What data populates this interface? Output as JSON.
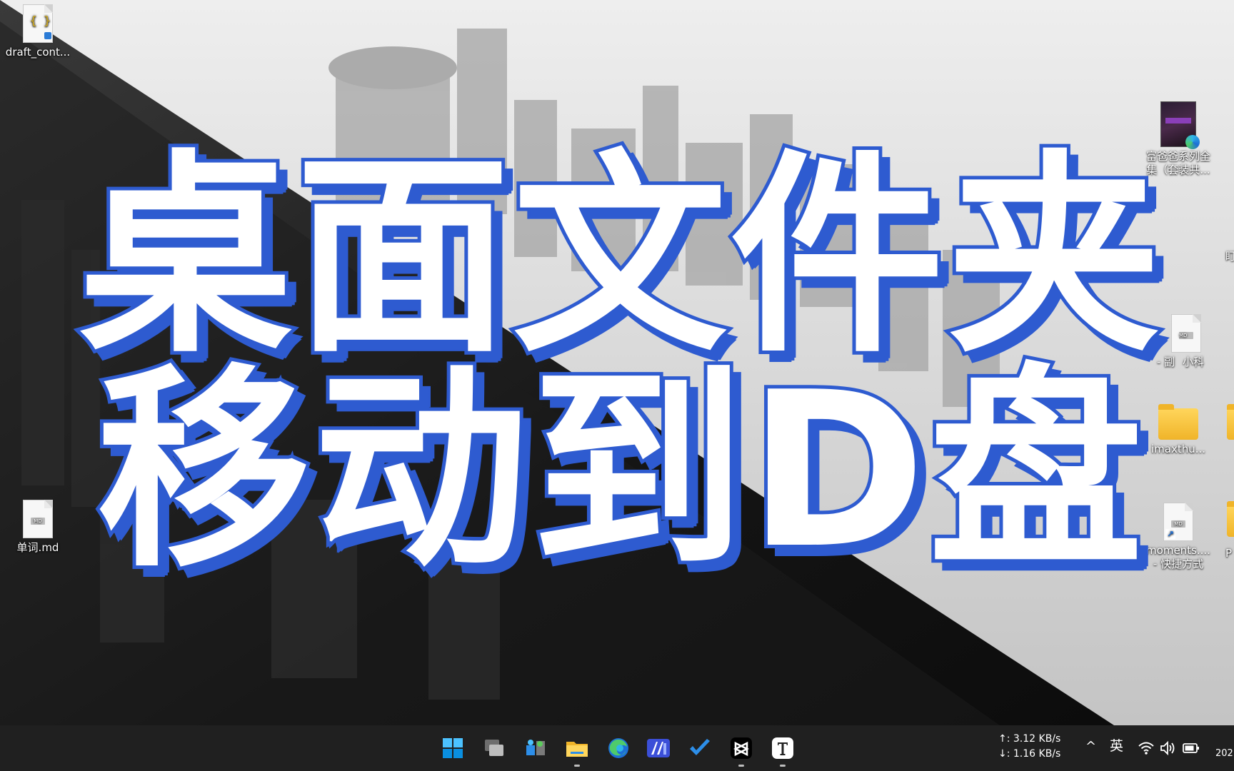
{
  "desktop": {
    "icons_left": [
      {
        "label": "draft_cont...",
        "kind": "json-file"
      },
      {
        "label": "单词.md",
        "kind": "md-file"
      }
    ],
    "icons_right": [
      {
        "label_line1": "富爸爸系列全",
        "label_line2": "集（套装共...",
        "kind": "ebook-shortcut"
      },
      {
        "label_line1": "- 副",
        "label_line2": "小科",
        "kind": "md-file-partial"
      },
      {
        "label_line1": "imaxthu...",
        "label_line2": "",
        "kind": "folder"
      },
      {
        "label_line1": "moments....",
        "label_line2": "- 快捷方式",
        "kind": "md-shortcut"
      }
    ],
    "right_edge_fragments": [
      "盯",
      "P"
    ]
  },
  "overlay_title": {
    "line1": "桌面文件夹",
    "line2": "移动到D盘",
    "fill_color": "#ffffff",
    "outline_color": "#2e5bd0"
  },
  "taskbar": {
    "apps": [
      {
        "name": "start-button",
        "icon": "windows-logo-icon"
      },
      {
        "name": "task-view-button",
        "icon": "task-view-icon"
      },
      {
        "name": "app-network",
        "icon": "network-app-icon"
      },
      {
        "name": "file-explorer",
        "icon": "folder-icon",
        "running": true
      },
      {
        "name": "edge",
        "icon": "edge-icon"
      },
      {
        "name": "app-ai",
        "icon": "ai-app-icon"
      },
      {
        "name": "todo",
        "icon": "checkmark-icon"
      },
      {
        "name": "capcut",
        "icon": "capcut-icon",
        "running": true
      },
      {
        "name": "typora",
        "icon": "typora-icon",
        "running": true
      }
    ],
    "net_speed": {
      "up": "↑: 3.12 KB/s",
      "down": "↓: 1.16 KB/s"
    },
    "tray": {
      "chevron": "^",
      "ime": "英",
      "clock_partial": "202"
    }
  }
}
